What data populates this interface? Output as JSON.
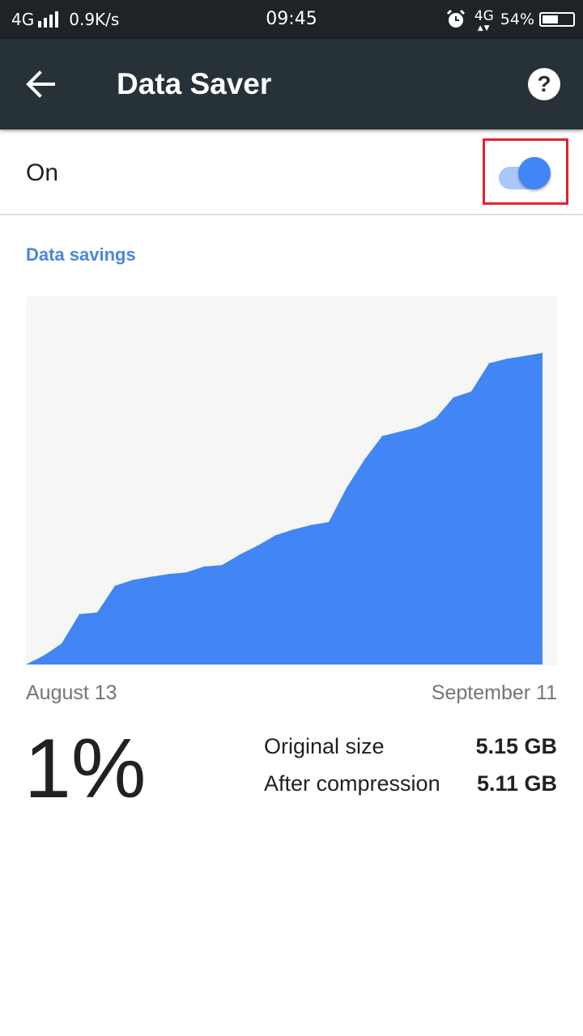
{
  "status_bar": {
    "network": "4G",
    "speed": "0.9K/s",
    "time": "09:45",
    "network_right": "4G",
    "battery": "54%",
    "battery_level": 0.54,
    "icons": [
      "signal-icon",
      "alarm-icon",
      "data-arrows-icon",
      "battery-icon"
    ]
  },
  "app_bar": {
    "title": "Data Saver",
    "icons": [
      "back-arrow-icon",
      "help-icon"
    ]
  },
  "toggle": {
    "label": "On",
    "state": true
  },
  "section": {
    "title": "Data savings"
  },
  "chart_data": {
    "type": "area",
    "x_start_label": "August 13",
    "x_end_label": "September 11",
    "values": [
      0,
      6,
      14,
      34,
      35,
      53,
      57,
      59,
      61,
      62,
      66,
      67,
      74,
      80,
      87,
      91,
      94,
      96,
      119,
      138,
      154,
      157,
      160,
      166,
      180,
      184,
      203,
      206,
      208,
      210
    ],
    "color": "#4285f4",
    "background": "#f6f6f6",
    "grid": false,
    "legend": "none"
  },
  "summary": {
    "percent": "1%",
    "rows": [
      {
        "label": "Original size",
        "value": "5.15 GB"
      },
      {
        "label": "After compression",
        "value": "5.11 GB"
      }
    ]
  },
  "colors": {
    "accent": "#4285f4",
    "app_bar": "#263238",
    "status_bar": "#1d2326",
    "highlight": "#e0232e",
    "section_title": "#4a87dc"
  }
}
